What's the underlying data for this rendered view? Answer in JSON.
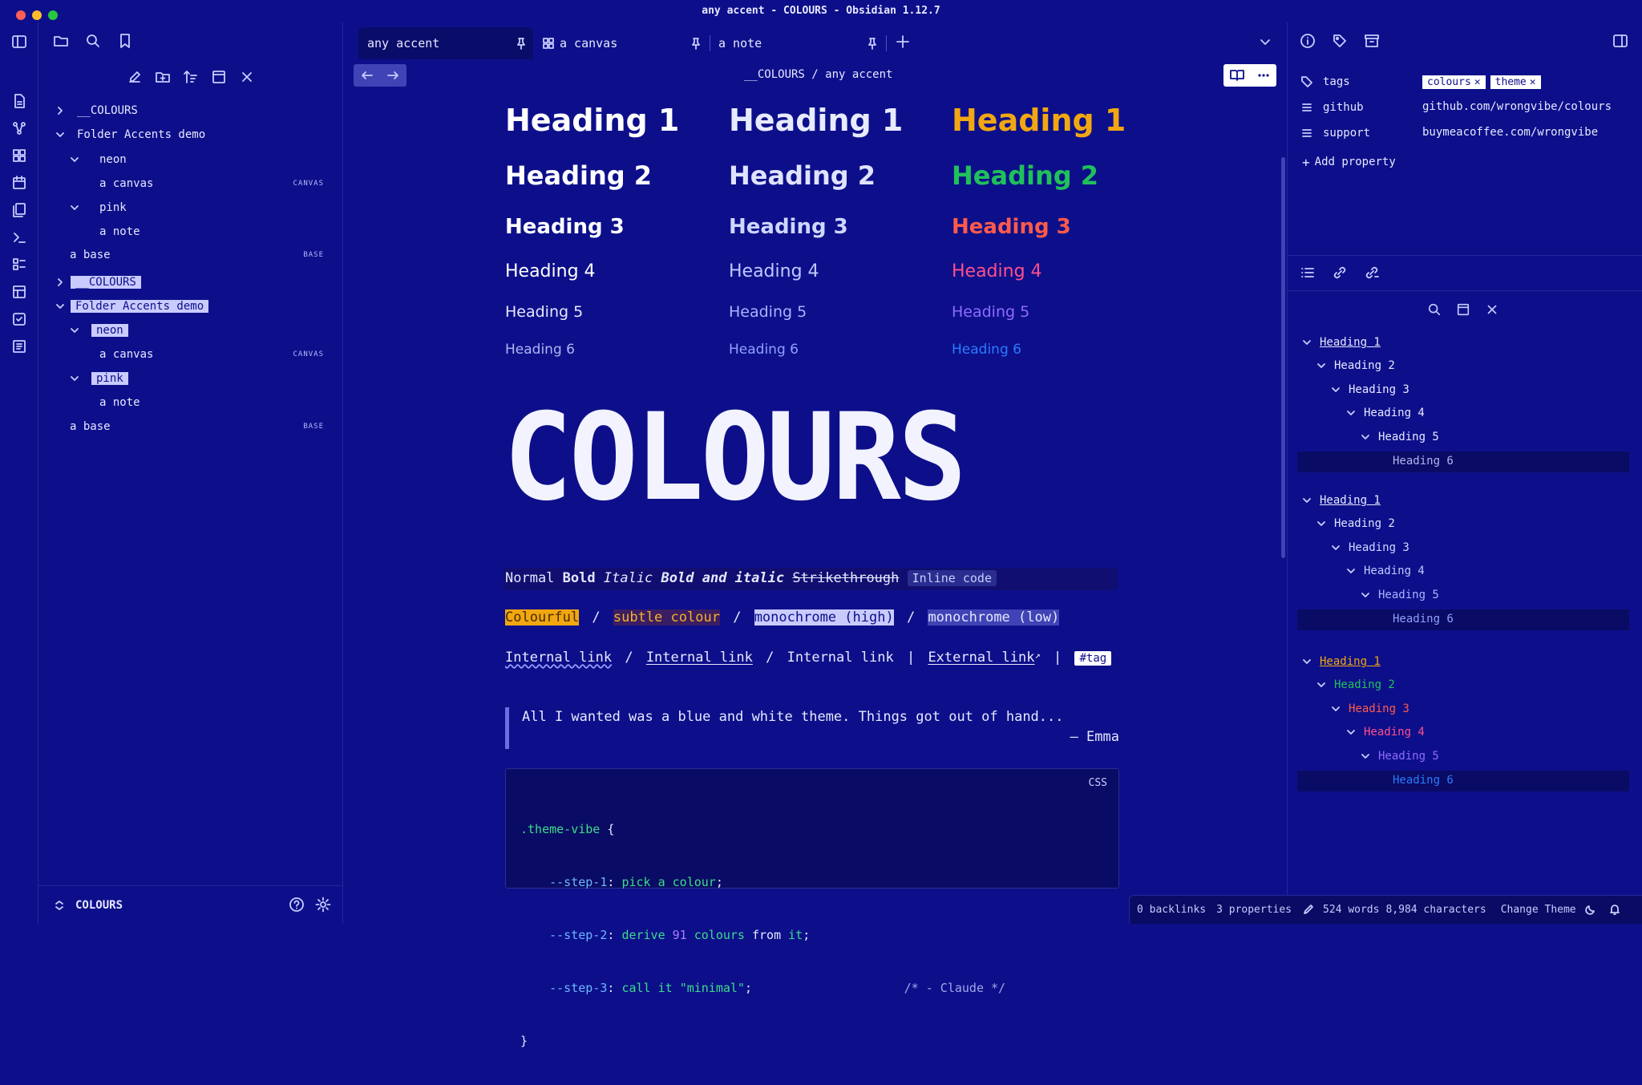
{
  "window": {
    "title": "any accent - COLOURS - Obsidian 1.12.7"
  },
  "tabs": [
    {
      "label": "any accent"
    },
    {
      "label": "a canvas"
    },
    {
      "label": "a note"
    }
  ],
  "breadcrumb": {
    "folder": "__COLOURS",
    "sep": "/",
    "note": "any accent"
  },
  "explorer": {
    "groups": [
      {
        "root": "__COLOURS",
        "folder": "Folder Accents demo",
        "sub1": "neon",
        "item1": "a canvas",
        "badge1": "CANVAS",
        "sub2": "pink",
        "item2": "a note",
        "base": "a base",
        "badge_base": "BASE"
      },
      {
        "root": "__COLOURS",
        "folder": "Folder Accents demo",
        "sub1": "neon",
        "item1": "a canvas",
        "badge1": "CANVAS",
        "sub2": "pink",
        "item2": "a note",
        "base": "a base",
        "badge_base": "BASE"
      }
    ],
    "vault_name": "COLOURS"
  },
  "headings": {
    "h1": "Heading 1",
    "h2": "Heading 2",
    "h3": "Heading 3",
    "h4": "Heading 4",
    "h5": "Heading 5",
    "h6": "Heading 6"
  },
  "logo_text": "COLOURS",
  "format_line": {
    "normal": "Normal",
    "bold": "Bold",
    "italic": "Italic",
    "bold_italic": "Bold and italic",
    "strike": "Strikethrough",
    "code": "Inline code"
  },
  "highlights": {
    "colourful": "Colourful",
    "subtle": "subtle colour",
    "mono_high": "monochrome (high)",
    "mono_low": "monochrome (low)",
    "sep": "/"
  },
  "links": {
    "internal1": "Internal link",
    "internal2": "Internal link",
    "internal3": "Internal link",
    "external": "External link",
    "tag": "#tag",
    "sep1": "/",
    "sep2": "/",
    "sep3": "|",
    "sep4": "|"
  },
  "quote": {
    "text": "All I wanted was a blue and white theme. Things got out of hand...",
    "author": "— Emma"
  },
  "code_block": {
    "lang": "CSS",
    "selector": ".theme-vibe",
    "brace_open": " {",
    "prop1": "--step-1",
    "val1": "pick a colour",
    "prop2": "--step-2",
    "val2a": "derive ",
    "val2num": "91",
    "val2b": " colours ",
    "val2from": "from",
    "val2it": " it",
    "prop3": "--step-3",
    "val3": "call it ",
    "val3str": "\"minimal\"",
    "comment": "/* - Claude */",
    "brace_close": "}",
    "colon": ": ",
    "semi": ";"
  },
  "properties": {
    "tags_key": "tags",
    "tags": [
      "colours",
      "theme"
    ],
    "github_key": "github",
    "github_val": "github.com/wrongvibe/colours",
    "support_key": "support",
    "support_val": "buymeacoffee.com/wrongvibe",
    "add": "Add property"
  },
  "outline": {
    "groups": [
      [
        "Heading 1",
        "Heading 2",
        "Heading 3",
        "Heading 4",
        "Heading 5",
        "Heading 6"
      ],
      [
        "Heading 1",
        "Heading 2",
        "Heading 3",
        "Heading 4",
        "Heading 5",
        "Heading 6"
      ],
      [
        "Heading 1",
        "Heading 2",
        "Heading 3",
        "Heading 4",
        "Heading 5",
        "Heading 6"
      ]
    ]
  },
  "status_bar": {
    "backlinks": "0 backlinks",
    "properties": "3 properties",
    "words": "524 words",
    "chars": "8,984 characters",
    "theme": "Change Theme"
  },
  "colors": {
    "bg": "#0d0f8a",
    "text": "#e6e8ff",
    "mono_col": "#8fa0ff",
    "accent_orange": "#f1a712",
    "accent_green": "#1fc15a",
    "accent_red": "#ff5a4a",
    "accent_pink": "#ff4f8b",
    "accent_violet": "#8f6bff",
    "accent_blue": "#2a7bff"
  }
}
